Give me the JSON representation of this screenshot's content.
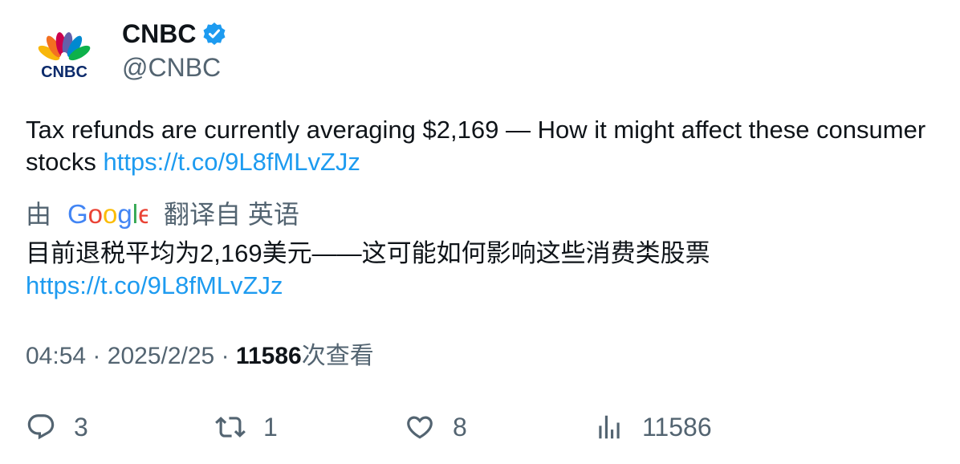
{
  "author": {
    "display_name": "CNBC",
    "handle": "@CNBC",
    "avatar_text": "CNBC",
    "verified": true
  },
  "tweet": {
    "text": "Tax refunds are currently averaging $2,169 — How it might affect these consumer stocks ",
    "link": "https://t.co/9L8fMLvZJz"
  },
  "translation": {
    "prefix": "由",
    "provider": "Google",
    "suffix": "翻译自 英语",
    "text": "目前退税平均为2,169美元——这可能如何影响这些消费类股票",
    "link": "https://t.co/9L8fMLvZJz"
  },
  "meta": {
    "time": "04:54",
    "separator": "·",
    "date": "2025/2/25",
    "views_count": "11586",
    "views_label": "次查看"
  },
  "actions": {
    "replies": "3",
    "retweets": "1",
    "likes": "8",
    "views": "11586"
  },
  "colors": {
    "link": "#1d9bf0",
    "secondary": "#536471",
    "primary": "#0f1419",
    "verified": "#1d9bf0"
  }
}
